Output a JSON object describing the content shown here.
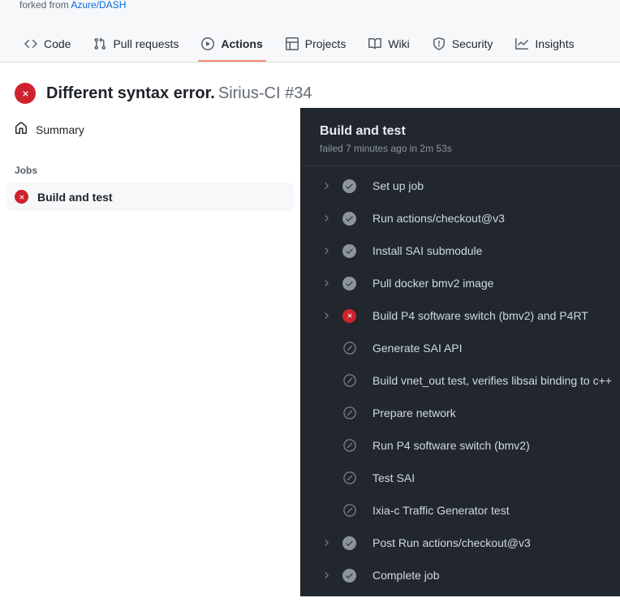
{
  "repo": {
    "forked_from_prefix": "forked from",
    "parent_repo": "Azure/DASH"
  },
  "nav": {
    "tabs": [
      {
        "label": "Code",
        "icon": "code-icon",
        "selected": false
      },
      {
        "label": "Pull requests",
        "icon": "git-pull-request-icon",
        "selected": false
      },
      {
        "label": "Actions",
        "icon": "play-circle-icon",
        "selected": true
      },
      {
        "label": "Projects",
        "icon": "table-icon",
        "selected": false
      },
      {
        "label": "Wiki",
        "icon": "book-icon",
        "selected": false
      },
      {
        "label": "Security",
        "icon": "shield-icon",
        "selected": false
      },
      {
        "label": "Insights",
        "icon": "graph-icon",
        "selected": false
      }
    ],
    "selected_underline_color": "#fd8c73"
  },
  "run": {
    "status": "failure",
    "status_icon": "x-circle-fill-icon",
    "title": "Different syntax error.",
    "workflow_and_number": "Sirius-CI #34",
    "fail_color": "#cf222e"
  },
  "sidebar": {
    "summary_label": "Summary",
    "summary_icon": "home-icon",
    "jobs_heading": "Jobs",
    "jobs": [
      {
        "name": "Build and test",
        "status": "failure",
        "status_icon": "x-circle-fill-icon",
        "selected": true
      }
    ]
  },
  "job_panel": {
    "title": "Build and test",
    "meta": "failed 7 minutes ago in 2m 53s",
    "background_color": "#22272e",
    "steps": [
      {
        "name": "Set up job",
        "status": "success",
        "status_icon": "check-circle-fill-icon",
        "expandable": true
      },
      {
        "name": "Run actions/checkout@v3",
        "status": "success",
        "status_icon": "check-circle-fill-icon",
        "expandable": true
      },
      {
        "name": "Install SAI submodule",
        "status": "success",
        "status_icon": "check-circle-fill-icon",
        "expandable": true
      },
      {
        "name": "Pull docker bmv2 image",
        "status": "success",
        "status_icon": "check-circle-fill-icon",
        "expandable": true
      },
      {
        "name": "Build P4 software switch (bmv2) and P4RT",
        "status": "failure",
        "status_icon": "x-circle-fill-icon",
        "expandable": true
      },
      {
        "name": "Generate SAI API",
        "status": "skipped",
        "status_icon": "skip-icon",
        "expandable": false
      },
      {
        "name": "Build vnet_out test, verifies libsai binding to c++",
        "status": "skipped",
        "status_icon": "skip-icon",
        "expandable": false
      },
      {
        "name": "Prepare network",
        "status": "skipped",
        "status_icon": "skip-icon",
        "expandable": false
      },
      {
        "name": "Run P4 software switch (bmv2)",
        "status": "skipped",
        "status_icon": "skip-icon",
        "expandable": false
      },
      {
        "name": "Test SAI",
        "status": "skipped",
        "status_icon": "skip-icon",
        "expandable": false
      },
      {
        "name": "Ixia-c Traffic Generator test",
        "status": "skipped",
        "status_icon": "skip-icon",
        "expandable": false
      },
      {
        "name": "Post Run actions/checkout@v3",
        "status": "success",
        "status_icon": "check-circle-fill-icon",
        "expandable": true
      },
      {
        "name": "Complete job",
        "status": "success",
        "status_icon": "check-circle-fill-icon",
        "expandable": true
      }
    ]
  }
}
